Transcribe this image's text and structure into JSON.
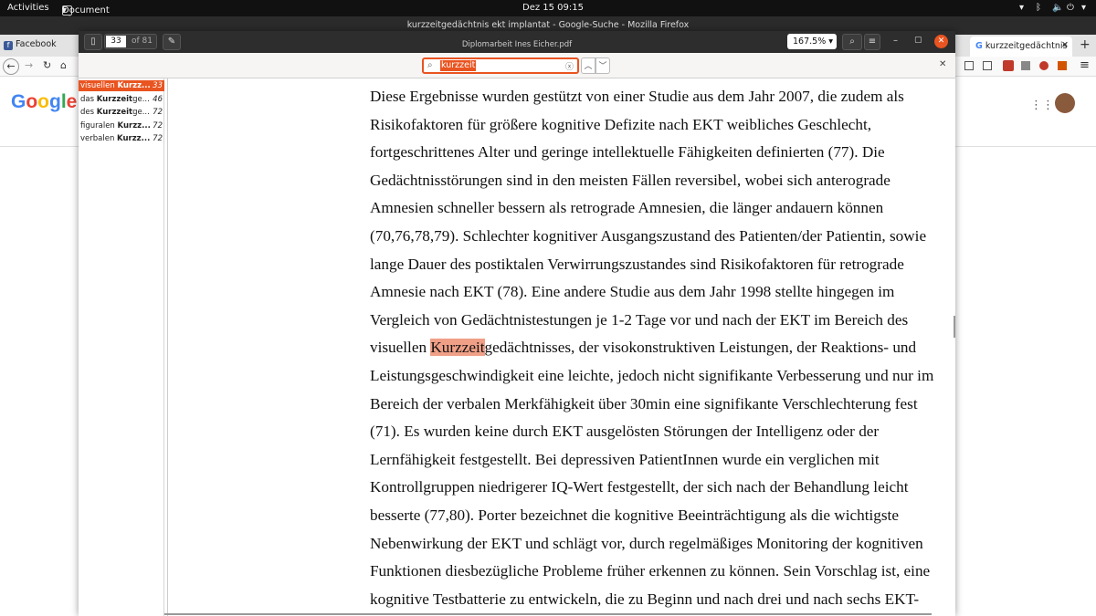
{
  "system": {
    "activities": "Activities",
    "app_menu": "Document Viewer",
    "clock": "Dez 15  09:15"
  },
  "firefox": {
    "window_title": "kurzzeitgedächtnis ekt implantat - Google-Suche - Mozilla Firefox",
    "tab_facebook": "Facebook",
    "tab_active": "kurzzeitgedächtnis",
    "google_logo": "Google"
  },
  "viewer": {
    "page_current": "33",
    "page_total": "of 81",
    "doc_title": "Diplomarbeit Ines Eicher.pdf",
    "zoom": "167.5%",
    "search_value": "kurzzeit",
    "results": [
      {
        "pre": "visuellen ",
        "match": "Kurzz...",
        "post": "",
        "page": "33",
        "selected": true
      },
      {
        "pre": "das ",
        "match": "Kurzzeit",
        "post": "ge...",
        "page": "46",
        "selected": false
      },
      {
        "pre": "des ",
        "match": "Kurzzeit",
        "post": "ge...",
        "page": "72",
        "selected": false
      },
      {
        "pre": "figuralen ",
        "match": "Kurzz...",
        "post": "",
        "page": "72",
        "selected": false
      },
      {
        "pre": "verbalen ",
        "match": "Kurzz...",
        "post": "",
        "page": "72",
        "selected": false
      }
    ],
    "lines": [
      "Diese Ergebnisse wurden gestützt von einer Studie aus dem Jahr 2007, die zudem als",
      "Risikofaktoren für größere kognitive Defizite nach EKT weibliches Geschlecht,",
      "fortgeschrittenes Alter und geringe intellektuelle Fähigkeiten definierten (77). Die",
      "Gedächtnisstörungen sind in den meisten Fällen reversibel, wobei sich anterograde",
      "Amnesien schneller bessern als retrograde Amnesien, die länger andauern können",
      "(70,76,78,79). Schlechter kognitiver Ausgangszustand des Patienten/der Patientin, sowie",
      "lange Dauer des postiktalen Verwirrungszustandes sind Risikofaktoren für retrograde",
      "Amnesie nach EKT (78). Eine andere Studie aus dem Jahr 1998 stellte hingegen im",
      "Vergleich von Gedächtnistestungen je 1-2 Tage vor und nach der EKT im Bereich des",
      "LINE_WITH_HIGHLIGHT",
      "Leistungsgeschwindigkeit eine leichte, jedoch nicht signifikante Verbesserung und nur im",
      "Bereich der verbalen Merkfähigkeit über 30min eine signifikante Verschlechterung fest",
      "(71). Es wurden keine durch EKT ausgelösten Störungen der Intelligenz oder der",
      "Lernfähigkeit festgestellt. Bei depressiven PatientInnen wurde ein verglichen mit",
      "Kontrollgruppen niedrigerer IQ-Wert festgestellt, der sich nach der Behandlung leicht",
      "besserte (77,80). Porter bezeichnet die kognitive Beeinträchtigung als die wichtigste",
      "Nebenwirkung der EKT und schlägt vor, durch regelmäßiges Monitoring der kognitiven",
      "Funktionen diesbezügliche Probleme früher erkennen zu können. Sein Vorschlag ist, eine",
      "kognitive Testbatterie zu entwickeln, die zu Beginn und nach drei und nach sechs EKT-"
    ],
    "hl_line": {
      "pre": "visuellen ",
      "match": "Kurzzeit",
      "post": "gedächtnisses, der visokonstruktiven Leistungen, der Reaktions- und"
    }
  },
  "colors": {
    "accent": "#e95420",
    "highlight": "#f0a087"
  }
}
